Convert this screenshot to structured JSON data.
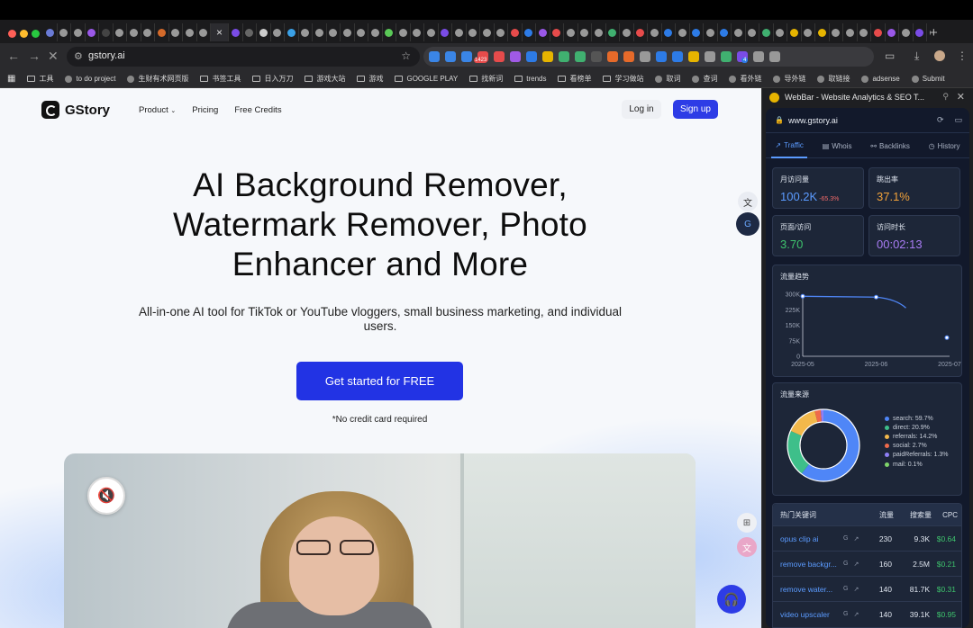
{
  "browser": {
    "tab_favicon_colors": [
      "#6a7bd6",
      "#999",
      "#999",
      "#9a58e8",
      "#444",
      "#999",
      "#999",
      "#999",
      "#d46a2a",
      "#999",
      "#999",
      "#999",
      "#7a4ce6",
      "#666",
      "#cccccc",
      "#999",
      "#3aa0e6",
      "#999",
      "#999",
      "#999",
      "#999",
      "#999",
      "#999",
      "#5ac857",
      "#999",
      "#999",
      "#999",
      "#7a4ce6",
      "#999",
      "#999",
      "#999",
      "#999",
      "#e64b4b",
      "#2d7be6",
      "#9a58e8",
      "#e64b4b",
      "#999",
      "#999",
      "#999",
      "#40b070",
      "#999",
      "#e64b4b",
      "#999",
      "#2d7be6",
      "#999",
      "#2d7be6",
      "#999",
      "#2d7be6",
      "#999",
      "#999",
      "#40b070",
      "#999",
      "#e6b400",
      "#999",
      "#e6b400",
      "#999",
      "#999",
      "#999",
      "#e64b4b",
      "#9a58e8",
      "#999",
      "#7a4ce6",
      "#999",
      "#999",
      "#40b070",
      "#999",
      "#e6b400",
      "#e6b400",
      "#e64b4b",
      "#e6a000",
      "#e6a000"
    ],
    "active_tab_close": "×",
    "new_tab": "+",
    "url": "gstory.ai",
    "badge_1423": "1423",
    "badge_4": "4",
    "ext_colors": [
      "#3a85e6",
      "#3a85e6",
      "#3a85e6",
      "#e64b4b",
      "#e64b4b",
      "#a05ae6",
      "#2d7be6",
      "#e6b400",
      "#40b070",
      "#40b070",
      "#555",
      "#e66a2a",
      "#e66a2a",
      "#999",
      "#2d7be6",
      "#2d7be6",
      "#e6b400",
      "#999",
      "#40b070",
      "#7a4ce6",
      "#999",
      "#999"
    ]
  },
  "bookmarks": [
    {
      "label": "工具"
    },
    {
      "label": "to do project"
    },
    {
      "label": "生财有术网页版"
    },
    {
      "label": "书签工具"
    },
    {
      "label": "日入万刀"
    },
    {
      "label": "游戏大站"
    },
    {
      "label": "游戏"
    },
    {
      "label": "GOOGLE PLAY"
    },
    {
      "label": "找新词"
    },
    {
      "label": "trends"
    },
    {
      "label": "看榜单"
    },
    {
      "label": "学习做站"
    },
    {
      "label": "取词"
    },
    {
      "label": "查词"
    },
    {
      "label": "看外链"
    },
    {
      "label": "导外链"
    },
    {
      "label": "取链接"
    },
    {
      "label": "adsense"
    },
    {
      "label": "Submit"
    }
  ],
  "site": {
    "logo_text": "GStory",
    "nav": {
      "product": "Product",
      "pricing": "Pricing",
      "free_credits": "Free Credits"
    },
    "login": "Log in",
    "signup": "Sign up",
    "hero_title": "AI Background Remover, Watermark Remover, Photo Enhancer and More",
    "hero_sub": "All-in-one AI tool for TikTok or YouTube vloggers, small business marketing, and individual users.",
    "cta": "Get started for FREE",
    "note": "*No credit card required"
  },
  "panel": {
    "title": "WebBar - Website Analytics & SEO T...",
    "domain": "www.gstory.ai",
    "tabs": [
      "Traffic",
      "Whois",
      "Backlinks",
      "History"
    ],
    "stats": {
      "monthly_visits_label": "月访问量",
      "monthly_visits": "100.2K",
      "monthly_change": "-65.3%",
      "bounce_label": "跳出率",
      "bounce": "37.1%",
      "pages_label": "页面/访问",
      "pages": "3.70",
      "duration_label": "访问时长",
      "duration": "00:02:13"
    },
    "trend_title": "流量趋势",
    "sources_title": "流量来源",
    "keywords": {
      "title": "热门关键词",
      "col_traffic": "流量",
      "col_volume": "搜索量",
      "col_cpc": "CPC",
      "rows": [
        {
          "kw": "opus clip ai",
          "traffic": "230",
          "volume": "9.3K",
          "cpc": "$0.64"
        },
        {
          "kw": "remove backgr...",
          "traffic": "160",
          "volume": "2.5M",
          "cpc": "$0.21"
        },
        {
          "kw": "remove water...",
          "traffic": "140",
          "volume": "81.7K",
          "cpc": "$0.31"
        },
        {
          "kw": "video upscaler",
          "traffic": "140",
          "volume": "39.1K",
          "cpc": "$0.95"
        }
      ]
    }
  },
  "chart_data": [
    {
      "type": "line",
      "title": "流量趋势",
      "x": [
        "2025-05",
        "2025-06",
        "2025-07"
      ],
      "series": [
        {
          "values": [
            290000,
            286000,
            90000
          ]
        }
      ],
      "ylim": [
        0,
        300000
      ],
      "yticks": [
        "0",
        "75K",
        "150K",
        "225K",
        "300K"
      ],
      "color": "#4f86f7"
    },
    {
      "type": "pie",
      "title": "流量来源",
      "labels": [
        "search: 59.7%",
        "direct: 20.9%",
        "referrals: 14.2%",
        "social: 2.7%",
        "paidReferrals: 1.3%",
        "mail: 0.1%"
      ],
      "values": [
        59.7,
        20.9,
        14.2,
        2.7,
        1.3,
        0.1
      ],
      "colors": [
        "#4f86f7",
        "#3ebf8a",
        "#f2b84b",
        "#ef6a4b",
        "#8f7ff5",
        "#7fd46a"
      ]
    }
  ]
}
